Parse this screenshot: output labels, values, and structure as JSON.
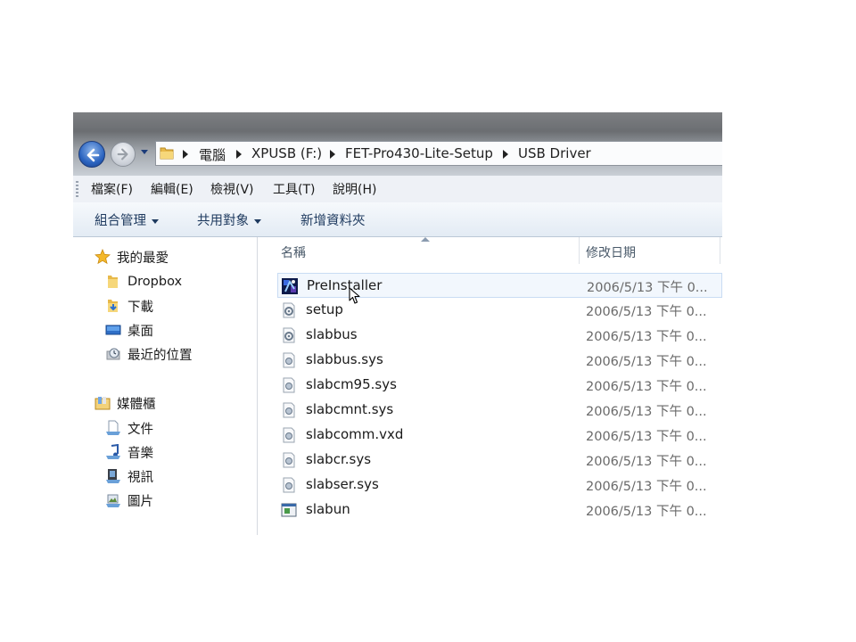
{
  "address": {
    "crumbs": [
      "電腦",
      "XPUSB (F:)",
      "FET-Pro430-Lite-Setup",
      "USB Driver"
    ]
  },
  "menu": [
    "檔案(F)",
    "編輯(E)",
    "檢視(V)",
    "工具(T)",
    "說明(H)"
  ],
  "commands": {
    "organize": "組合管理",
    "share": "共用對象",
    "new_folder": "新增資料夾"
  },
  "nav": {
    "favorites": {
      "label": "我的最愛",
      "items": [
        "Dropbox",
        "下載",
        "桌面",
        "最近的位置"
      ]
    },
    "libraries": {
      "label": "媒體櫃",
      "items": [
        "文件",
        "音樂",
        "視訊",
        "圖片"
      ]
    }
  },
  "columns": {
    "name": "名稱",
    "date": "修改日期"
  },
  "files": [
    {
      "name": "PreInstaller",
      "date": "2006/5/13 下午 0...",
      "icon": "installer-icon"
    },
    {
      "name": "setup",
      "date": "2006/5/13 下午 0...",
      "icon": "config-file-icon"
    },
    {
      "name": "slabbus",
      "date": "2006/5/13 下午 0...",
      "icon": "config-file-icon"
    },
    {
      "name": "slabbus.sys",
      "date": "2006/5/13 下午 0...",
      "icon": "system-file-icon"
    },
    {
      "name": "slabcm95.sys",
      "date": "2006/5/13 下午 0...",
      "icon": "system-file-icon"
    },
    {
      "name": "slabcmnt.sys",
      "date": "2006/5/13 下午 0...",
      "icon": "system-file-icon"
    },
    {
      "name": "slabcomm.vxd",
      "date": "2006/5/13 下午 0...",
      "icon": "system-file-icon"
    },
    {
      "name": "slabcr.sys",
      "date": "2006/5/13 下午 0...",
      "icon": "system-file-icon"
    },
    {
      "name": "slabser.sys",
      "date": "2006/5/13 下午 0...",
      "icon": "system-file-icon"
    },
    {
      "name": "slabun",
      "date": "2006/5/13 下午 0...",
      "icon": "application-icon"
    }
  ],
  "selected_file": "PreInstaller"
}
